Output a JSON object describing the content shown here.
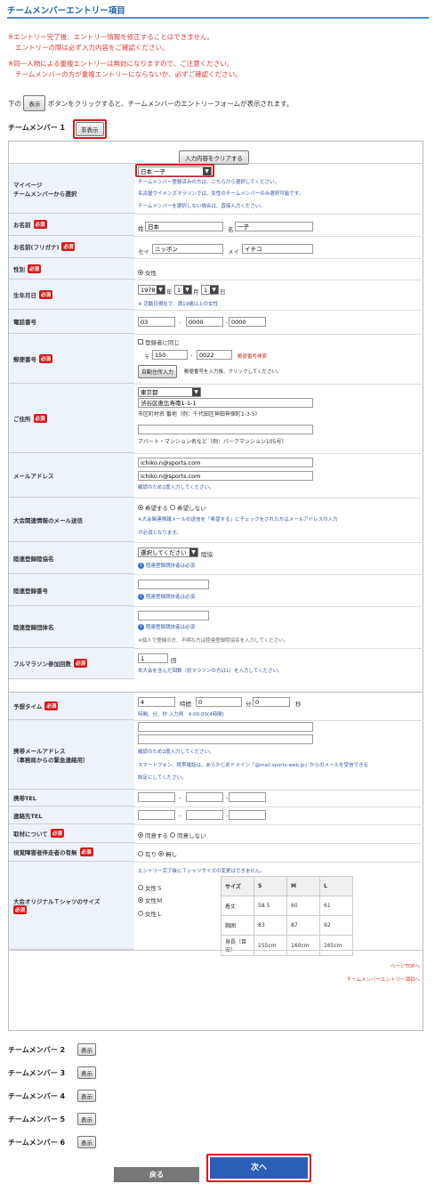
{
  "page": {
    "title": "チームメンバーエントリー項目"
  },
  "notes": [
    "※エントリー完了後、エントリー情報を修正することはできません。",
    "エントリーの際は必ず入力内容をご確認ください。",
    "※同一人物による重複エントリーは無効になりますので、ご注意ください。",
    "チームメンバーの方が重複エントリーにならないか、必ずご確認ください。"
  ],
  "instruction": {
    "before": "下の",
    "button": "表示",
    "after": "ボタンをクリックすると、チームメンバーのエントリーフォームが表示されます。"
  },
  "member1": {
    "label": "チームメンバー 1",
    "toggle": "非表示"
  },
  "clear_button": "入力内容をクリアする",
  "required": "必須",
  "rows": {
    "mypage": {
      "label1": "マイページ",
      "label2": "チームメンバーから選択",
      "select": "日本 一子",
      "h1": "チームメンバー登録済みの方は、こちらから選択してください。",
      "h2": "名古屋ウイメンズマラソンでは、女性のチームメンバーのみ選択可能です。",
      "h3": "チームメンバーを選択しない場合は、直接入力ください。"
    },
    "name": {
      "label": "お名前",
      "sei_l": "姓",
      "sei": "日本",
      "mei_l": "名",
      "mei": "一子"
    },
    "kana": {
      "label": "お名前(フリガナ)",
      "sei_l": "セイ",
      "sei": "ニッポン",
      "mei_l": "メイ",
      "mei": "イチコ"
    },
    "gender": {
      "label": "性別",
      "value": "女性"
    },
    "birth": {
      "label": "生年月日",
      "year": "1978",
      "month": "1",
      "day": "1",
      "y_l": "年",
      "m_l": "月",
      "d_l": "日",
      "note": "※ 活動日現在で、満19歳以上の女性"
    },
    "tel": {
      "label": "電話番号",
      "a": "03",
      "b": "0000",
      "c": "0000",
      "dash": "-"
    },
    "zip": {
      "label": "郵便番号",
      "same": "登録者に同じ",
      "mark": "〒",
      "a": "150",
      "b": "0022",
      "lookup": "郵便番号検索",
      "auto": "自動住所入力",
      "autonote": "郵便番号を入力後、クリックしてください。",
      "dash": "-"
    },
    "addr": {
      "label": "ご住所",
      "pref": "東京都",
      "line1": "渋谷区恵比寿南1-1-1",
      "ex1": "市区町村名 番地（例：千代田区神田神保町1-3-5）",
      "ex2": "アパート・マンション名など（例：パークマンション105号）"
    },
    "email": {
      "label": "メールアドレス",
      "v1": "ichiko.n@sports.com",
      "v2": "ichiko.n@sports.com",
      "note": "確認のため2度入力してください。"
    },
    "mailopt": {
      "label": "大会関連情報のメール送信",
      "yes": "希望する",
      "no": "希望しない",
      "note1": "※大会関連情報メールの送信を「希望する」にチェックをされた方はメールアドレスの入力",
      "note2": "が必須となります。"
    },
    "rikuren": {
      "label": "陸連登録陸協名",
      "select": "選択してください",
      "after": "陸協",
      "note": "陸連登録競技者は必須"
    },
    "rikunum": {
      "label": "陸連登録番号",
      "note": "陸連登録競技者は必須"
    },
    "rikudan": {
      "label": "陸連登録団体名",
      "note": "陸連登録競技者は必須",
      "note2": "※個人で登録の方、不明な方は陸連登録陸協名を入力してください。"
    },
    "full": {
      "label": "フルマラソン参加回数",
      "value": "1",
      "unit": "回",
      "note": "本大会を含んだ回数（初マラソンの方は1）を入力してください。"
    },
    "time": {
      "label": "予想タイム",
      "h": "4",
      "hl": "時間",
      "m": "0",
      "ml": "分",
      "s": "0",
      "sl": "秒",
      "note": "時間、分、秒 入力例　4:00:00(4時間)"
    },
    "mobile": {
      "label1": "携帯メールアドレス",
      "label2": "（事務局からの緊急連絡用）",
      "n1": "確認のため2度入力してください。",
      "n2": "スマートフォン、携帯電話は、あらかじめドメイン「@mail.sports-web.jp」からのメールを受信できる",
      "n3": "設定にしてください。"
    },
    "mtel": {
      "label": "携帯TEL",
      "dash": "-"
    },
    "ctel": {
      "label": "連絡先TEL",
      "dash": "-"
    },
    "press": {
      "label": "取材について",
      "yes": "同意する",
      "no": "同意しない"
    },
    "blind": {
      "label": "視覚障害者伴走者の有無",
      "yes": "有り",
      "no": "無し"
    },
    "shirt": {
      "label": "大会オリジナルＴシャツのサイズ",
      "note": "エントリー完了後にＴシャツサイズの変更はできません。",
      "s": "女性Ｓ",
      "m": "女性Ｍ",
      "l": "女性Ｌ",
      "table": [
        [
          "サイズ",
          "S",
          "M",
          "L"
        ],
        [
          "着丈",
          "58.5",
          "60",
          "61"
        ],
        [
          "胸囲",
          "83",
          "87",
          "92"
        ],
        [
          "身長（目安）",
          "155cm",
          "160cm",
          "165cm"
        ]
      ]
    }
  },
  "links": {
    "top": "ページTOPへ",
    "entry": "チームメンバーエントリー項目へ"
  },
  "members": [
    {
      "label": "チームメンバー 2",
      "btn": "表示"
    },
    {
      "label": "チームメンバー 3",
      "btn": "表示"
    },
    {
      "label": "チームメンバー 4",
      "btn": "表示"
    },
    {
      "label": "チームメンバー 5",
      "btn": "表示"
    },
    {
      "label": "チームメンバー 6",
      "btn": "表示"
    }
  ],
  "footer": {
    "back": "戻る",
    "next": "次へ"
  }
}
